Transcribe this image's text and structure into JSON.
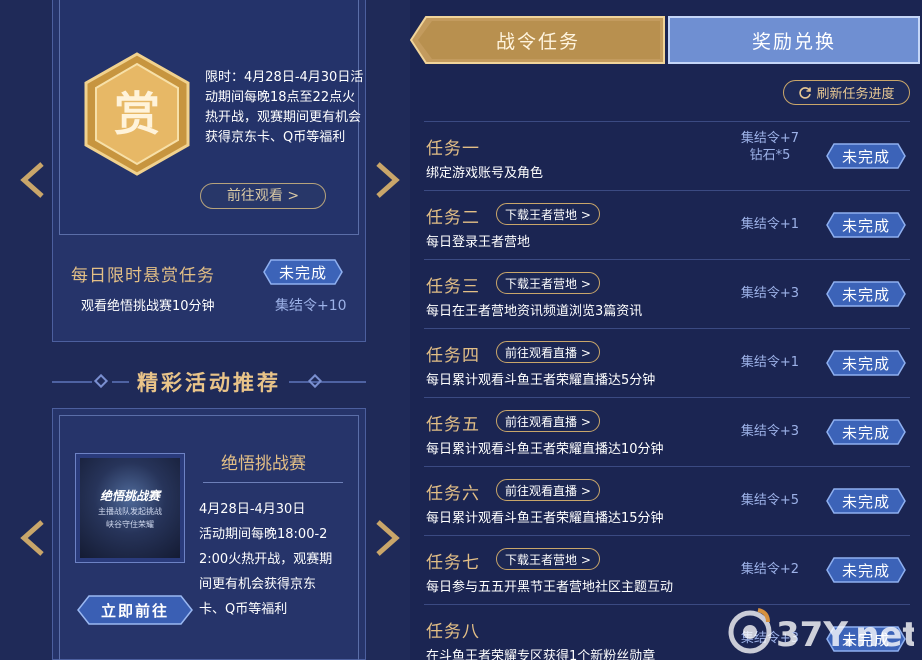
{
  "bounty": {
    "badge_char": "赏",
    "description": "限时：4月28日-4月30日活动期间每晚18点至22点火热开战，观赛期间更有机会获得京东卡、Q币等福利",
    "watch_button": "前往观看 >",
    "daily_title": "每日限时悬赏任务",
    "daily_status": "未完成",
    "daily_desc": "观看绝悟挑战赛10分钟",
    "daily_reward": "集结令+10"
  },
  "recommend": {
    "heading": "精彩活动推荐",
    "activity_title": "绝悟挑战赛",
    "thumb_title": "绝悟挑战赛",
    "thumb_sub1": "主播战队发起挑战",
    "thumb_sub2": "峡谷守住荣耀",
    "dates": "4月28日-4月30日",
    "desc_lines": [
      "活动期间每晚18:00-2",
      "2:00火热开战，观赛期",
      "间更有机会获得京东",
      "卡、Q币等福利"
    ],
    "go_button": "立即前往"
  },
  "tabs": {
    "active": "战令任务",
    "inactive": "奖励兑换"
  },
  "refresh_label": "刷新任务进度",
  "tasks": [
    {
      "name": "任务一",
      "link": "",
      "desc": "绑定游戏账号及角色",
      "reward_lines": [
        "集结令+7",
        "钻石*5"
      ],
      "status": "未完成"
    },
    {
      "name": "任务二",
      "link": "下载王者营地 >",
      "desc": "每日登录王者营地",
      "reward_lines": [
        "集结令+1"
      ],
      "status": "未完成"
    },
    {
      "name": "任务三",
      "link": "下载王者营地 >",
      "desc": "每日在王者营地资讯频道浏览3篇资讯",
      "reward_lines": [
        "集结令+3"
      ],
      "status": "未完成"
    },
    {
      "name": "任务四",
      "link": "前往观看直播 >",
      "desc": "每日累计观看斗鱼王者荣耀直播达5分钟",
      "reward_lines": [
        "集结令+1"
      ],
      "status": "未完成"
    },
    {
      "name": "任务五",
      "link": "前往观看直播 >",
      "desc": "每日累计观看斗鱼王者荣耀直播达10分钟",
      "reward_lines": [
        "集结令+3"
      ],
      "status": "未完成"
    },
    {
      "name": "任务六",
      "link": "前往观看直播 >",
      "desc": "每日累计观看斗鱼王者荣耀直播达15分钟",
      "reward_lines": [
        "集结令+5"
      ],
      "status": "未完成"
    },
    {
      "name": "任务七",
      "link": "下载王者营地 >",
      "desc": "每日参与五五开黑节王者营地社区主题互动",
      "reward_lines": [
        "集结令+2"
      ],
      "status": "未完成"
    },
    {
      "name": "任务八",
      "link": "",
      "desc": "在斗鱼王者荣耀专区获得1个新粉丝勋章",
      "reward_lines": [
        "集结令+3"
      ],
      "status": "未完成"
    }
  ],
  "watermark": "37Y.net",
  "colors": {
    "gold": "#e3bf86",
    "reward_blue": "#9db2e8",
    "badge_blue": "#3c63b8",
    "background": "#1c2550"
  }
}
